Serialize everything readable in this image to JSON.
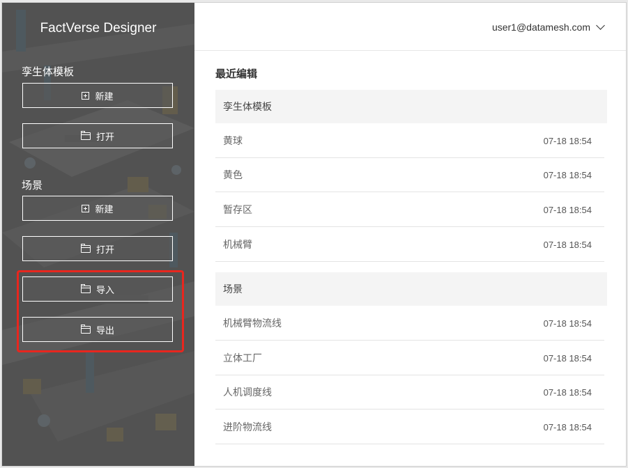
{
  "app": {
    "brand": "FactVerse Designer"
  },
  "header": {
    "user_email": "user1@datamesh.com"
  },
  "sidebar": {
    "template_section": {
      "label": "孪生体模板",
      "new_label": "新建",
      "open_label": "打开"
    },
    "scene_section": {
      "label": "场景",
      "new_label": "新建",
      "open_label": "打开",
      "import_label": "导入",
      "export_label": "导出"
    }
  },
  "main": {
    "title": "最近编辑",
    "template_group": {
      "label": "孪生体模板",
      "rows": [
        {
          "name": "黄球",
          "time": "07-18 18:54"
        },
        {
          "name": "黄色",
          "time": "07-18 18:54"
        },
        {
          "name": "暂存区",
          "time": "07-18 18:54"
        },
        {
          "name": "机械臂",
          "time": "07-18 18:54"
        }
      ]
    },
    "scene_group": {
      "label": "场景",
      "rows": [
        {
          "name": "机械臂物流线",
          "time": "07-18 18:54"
        },
        {
          "name": "立体工厂",
          "time": "07-18 18:54"
        },
        {
          "name": "人机调度线",
          "time": "07-18 18:54"
        },
        {
          "name": "进阶物流线",
          "time": "07-18 18:54"
        }
      ]
    }
  },
  "colors": {
    "highlight": "#e8261e",
    "sidebar": "#5c5c5c"
  }
}
